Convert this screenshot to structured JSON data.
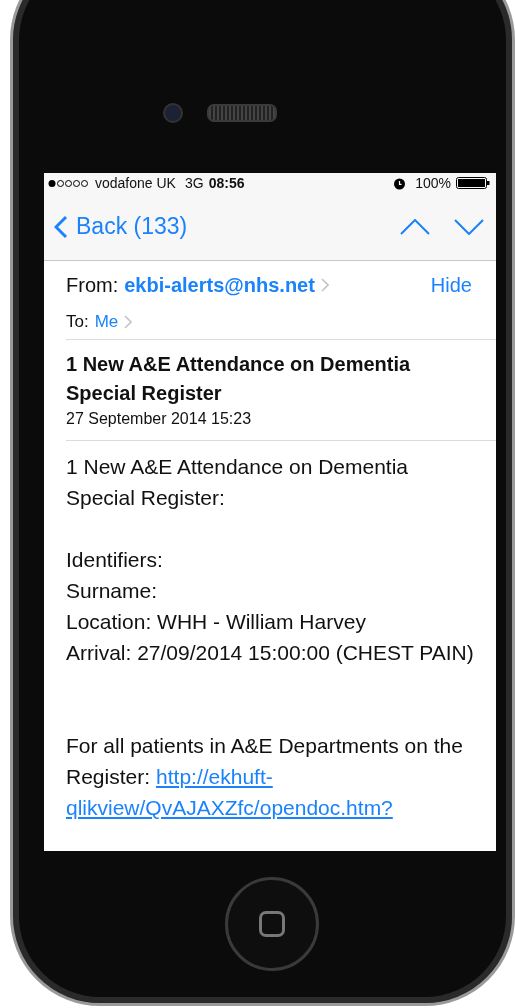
{
  "status_bar": {
    "carrier": "vodafone UK",
    "network": "3G",
    "time": "08:56",
    "battery_text": "100%"
  },
  "nav_bar": {
    "back_label": "Back (133)"
  },
  "header": {
    "from_label": "From:",
    "sender": "ekbi-alerts@nhs.net",
    "hide_label": "Hide",
    "to_label": "To:",
    "recipient": "Me"
  },
  "subject": "1 New A&E Attendance on Dementia Special Register",
  "date": "27 September 2014 15:23",
  "body": {
    "paragraphs": [
      {
        "lines": [
          "1 New A&E Attendance on Dementia Special Register:"
        ]
      },
      {
        "lines": [
          "Identifiers:",
          "Surname:",
          "Location: WHH - William Harvey",
          "Arrival: 27/09/2014 15:00:00 (CHEST PAIN)"
        ]
      },
      {
        "lines": [
          "For all patients in A&E Departments on the",
          "Register:"
        ],
        "link_lines": [
          "http://ekhuft-",
          "qlikview/QvAJAXZfc/opendoc.htm?"
        ]
      }
    ]
  }
}
